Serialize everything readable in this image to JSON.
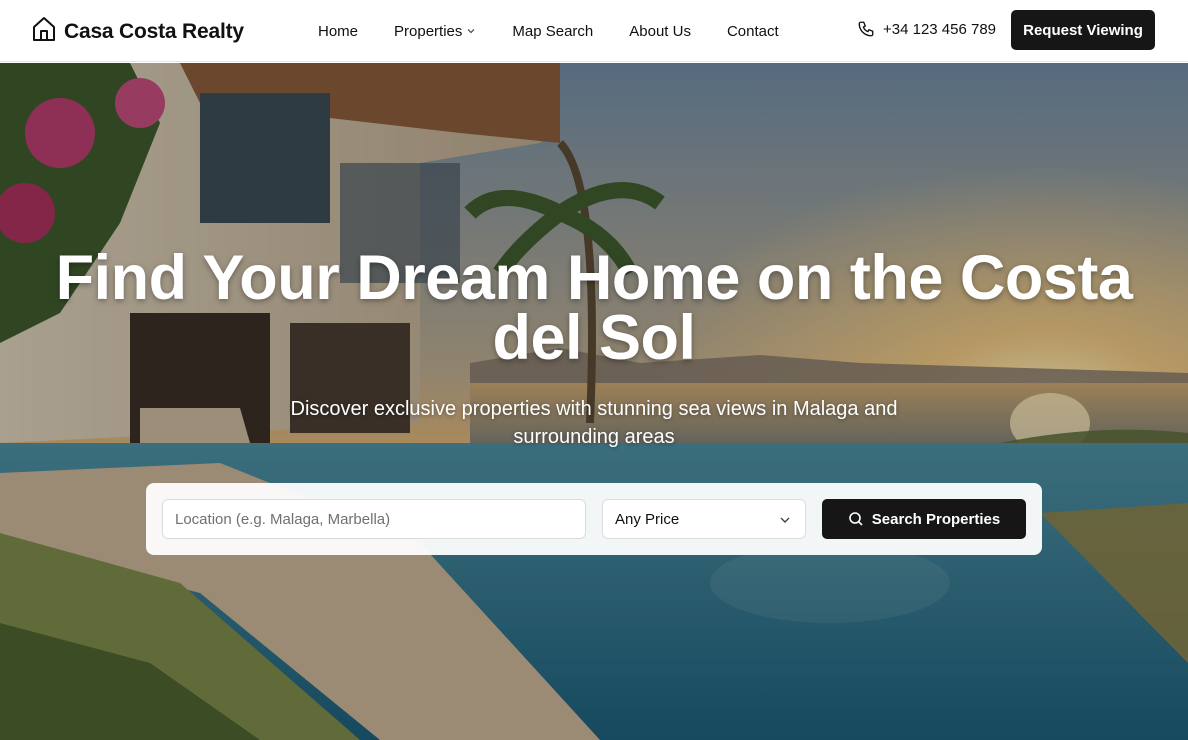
{
  "brand": {
    "name": "Casa Costa Realty",
    "icon": "home-icon"
  },
  "nav": {
    "items": [
      {
        "label": "Home"
      },
      {
        "label": "Properties",
        "icon": "chevron-down-icon"
      },
      {
        "label": "Map Search"
      },
      {
        "label": "About Us"
      },
      {
        "label": "Contact"
      }
    ]
  },
  "header": {
    "phone": "+34 123 456 789",
    "phone_icon": "phone-icon",
    "cta_label": "Request Viewing"
  },
  "hero": {
    "title_line1": "Find Your Dream Home on the Costa",
    "title_line2": "del Sol",
    "subtitle_line1": "Discover exclusive properties with stunning sea views in Malaga and",
    "subtitle_line2": "surrounding areas"
  },
  "search": {
    "location_placeholder": "Location (e.g. Malaga, Marbella)",
    "location_value": "",
    "price_selected": "Any Price",
    "button_label": "Search Properties",
    "button_icon": "search-icon"
  },
  "colors": {
    "primary_dark": "#161616",
    "header_bg": "#ffffff",
    "text_on_hero": "#ffffff"
  }
}
